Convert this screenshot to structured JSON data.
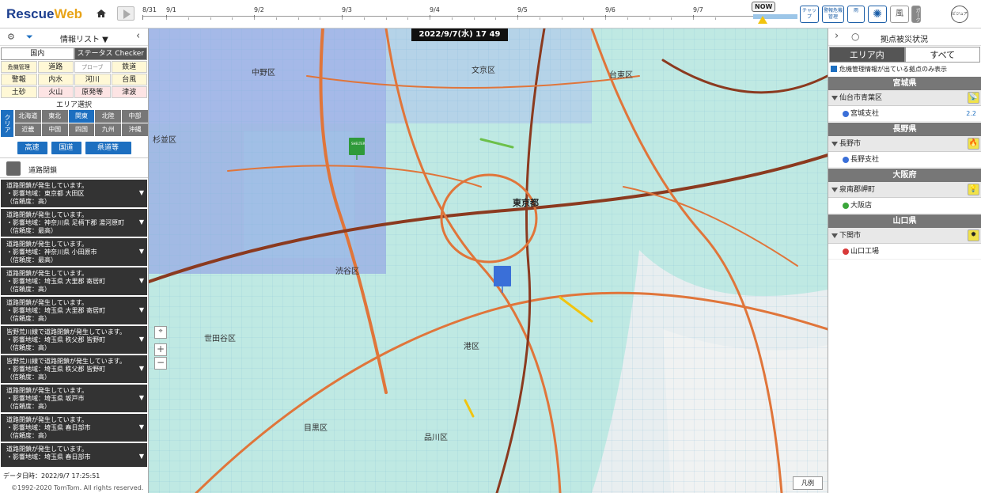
{
  "app": {
    "logo_part1": "Rescue",
    "logo_part2": "Web"
  },
  "timeline": {
    "ticks": [
      "8/31",
      "9/1",
      "9/2",
      "9/3",
      "9/4",
      "9/5",
      "9/6",
      "9/7"
    ],
    "now_label": "NOW"
  },
  "toolbar": {
    "buttons": [
      "チャップ",
      "警報危機管理",
      "雨",
      "",
      "風",
      "ガーク"
    ],
    "circle_button": "ビジュアル"
  },
  "left_panel": {
    "title": "情報リスト ▼",
    "tabs": [
      "国内",
      "ステータス Checker"
    ],
    "categories": [
      "危機管理",
      "道路",
      "プローブ",
      "鉄道",
      "警報",
      "内水",
      "河川",
      "台風",
      "土砂",
      "火山",
      "原発等",
      "津波"
    ],
    "area_label": "エリア選択",
    "clear_label": "クリア",
    "regions": [
      "北海道",
      "東北",
      "関東",
      "北陸",
      "中部",
      "近畿",
      "中国",
      "四国",
      "九州",
      "沖縄"
    ],
    "road_buttons": [
      "高速",
      "国道",
      "県道等"
    ],
    "section_title": "道路閉鎖",
    "messages": [
      {
        "l1": "道路閉鎖が発生しています。",
        "l2": "・影響地域：東京都 大田区",
        "l3": "（信頼度：高）"
      },
      {
        "l1": "道路閉鎖が発生しています。",
        "l2": "・影響地域：神奈川県 足柄下郡 湯河原町",
        "l3": "（信頼度：最高）"
      },
      {
        "l1": "道路閉鎖が発生しています。",
        "l2": "・影響地域：神奈川県 小田原市",
        "l3": "（信頼度：最高）"
      },
      {
        "l1": "道路閉鎖が発生しています。",
        "l2": "・影響地域：埼玉県 大里郡 寄居町",
        "l3": "（信頼度：高）"
      },
      {
        "l1": "道路閉鎖が発生しています。",
        "l2": "・影響地域：埼玉県 大里郡 寄居町",
        "l3": "（信頼度：高）"
      },
      {
        "l1": "皆野荒川線で道路閉鎖が発生しています。",
        "l2": "・影響地域：埼玉県 秩父郡 皆野町",
        "l3": "（信頼度：高）"
      },
      {
        "l1": "皆野荒川線で道路閉鎖が発生しています。",
        "l2": "・影響地域：埼玉県 秩父郡 皆野町",
        "l3": "（信頼度：高）"
      },
      {
        "l1": "道路閉鎖が発生しています。",
        "l2": "・影響地域：埼玉県 坂戸市",
        "l3": "（信頼度：高）"
      },
      {
        "l1": "道路閉鎖が発生しています。",
        "l2": "・影響地域：埼玉県 春日部市",
        "l3": "（信頼度：高）"
      },
      {
        "l1": "道路閉鎖が発生しています。",
        "l2": "・影響地域：埼玉県 春日部市",
        "l3": ""
      }
    ],
    "data_time": "データ日時：2022/9/7 17:25:51",
    "copyright": "©1992-2020 TomTom. All rights reserved."
  },
  "map": {
    "date_badge": "2022/9/7(水)  17 49",
    "legend_button": "凡例",
    "zoom_in": "+",
    "zoom_out": "−",
    "labels": [
      "中野区",
      "文京区",
      "台東区",
      "杉並区",
      "東京都",
      "渋谷区",
      "世田谷区",
      "港区",
      "目黒区",
      "品川区"
    ],
    "shelter_sign": "SHELTER"
  },
  "right_panel": {
    "title": "拠点被災状況",
    "tabs": [
      "エリア内",
      "すべて"
    ],
    "checkbox_label": "危機管理情報が出ている拠点のみ表示",
    "prefectures": [
      {
        "name": "宮城県",
        "city": "仙台市青葉区",
        "site": "宮城支社",
        "dot": "#3a6fd8",
        "value": "2.2",
        "hazard": "📡"
      },
      {
        "name": "長野県",
        "city": "長野市",
        "site": "長野支社",
        "dot": "#3a6fd8",
        "value": "",
        "hazard": "🔥"
      },
      {
        "name": "大阪府",
        "city": "泉南郡岬町",
        "site": "大阪店",
        "dot": "#3aa63a",
        "value": "",
        "hazard": "💡"
      },
      {
        "name": "山口県",
        "city": "下関市",
        "site": "山口工場",
        "dot": "#d83a3a",
        "value": "",
        "hazard": "✹"
      }
    ]
  }
}
